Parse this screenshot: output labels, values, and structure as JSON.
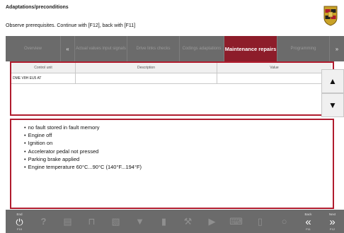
{
  "header": {
    "title": "Adaptations/preconditions",
    "instruction": "Observe prerequisites. Continue with [F12], back with [F11]"
  },
  "colors": {
    "accent": "#b01c2e",
    "active_tab": "#8d1d2a",
    "bar": "#6b6b6b"
  },
  "tabs": [
    {
      "label": "Overview"
    },
    {
      "label": "«"
    },
    {
      "label": "Actual values input signals"
    },
    {
      "label": "Drive links checks"
    },
    {
      "label": "Codings adaptations"
    },
    {
      "label": "Maintenance repairs",
      "active": true
    },
    {
      "label": "Programming"
    },
    {
      "label": "»"
    }
  ],
  "table": {
    "columns": [
      "Control unit",
      "Description",
      "Value"
    ],
    "rows": [
      [
        "DME V8H EU5 AT",
        "",
        ""
      ]
    ]
  },
  "scroll": {
    "up_icon": "triangle-up",
    "down_icon": "triangle-down"
  },
  "conditions": [
    "no fault stored in fault memory",
    "Engine off",
    "Ignition on",
    "Accelerator pedal not pressed",
    "Parking brake applied",
    "Engine temperature 60°C...90°C (140°F...194°F)"
  ],
  "toolbar": {
    "end_label": "End",
    "end_key": "F10",
    "back_label": "Back",
    "back_key": "F11",
    "next_label": "Next",
    "next_key": "F12"
  }
}
